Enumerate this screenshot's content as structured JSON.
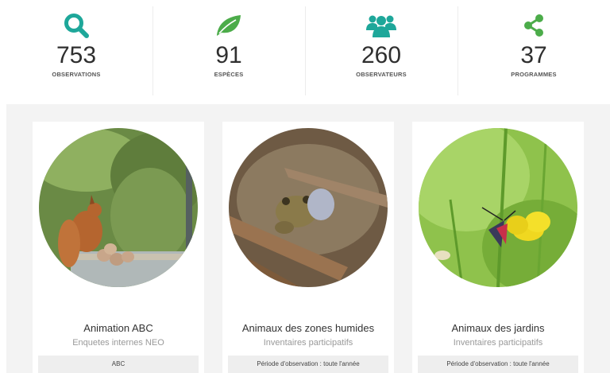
{
  "stats": [
    {
      "value": "753",
      "label": "OBSERVATIONS",
      "icon": "search-icon",
      "color": "#1ea79a"
    },
    {
      "value": "91",
      "label": "ESPÈCES",
      "icon": "leaf-icon",
      "color": "#4cac4a"
    },
    {
      "value": "260",
      "label": "OBSERVATEURS",
      "icon": "users-icon",
      "color": "#1ea79a"
    },
    {
      "value": "37",
      "label": "PROGRAMMES",
      "icon": "share-icon",
      "color": "#4cac4a"
    }
  ],
  "programs": [
    {
      "title": "Animation ABC",
      "subtitle": "Enquetes internes NEO",
      "tag": "ABC",
      "image": "squirrel-photo"
    },
    {
      "title": "Animaux des zones humides",
      "subtitle": "Inventaires participatifs",
      "tag": "Période d'observation : toute l'année",
      "image": "toad-photo"
    },
    {
      "title": "Animaux des jardins",
      "subtitle": "Inventaires participatifs",
      "tag": "Période d'observation : toute l'année",
      "image": "moth-on-flower-photo"
    }
  ]
}
